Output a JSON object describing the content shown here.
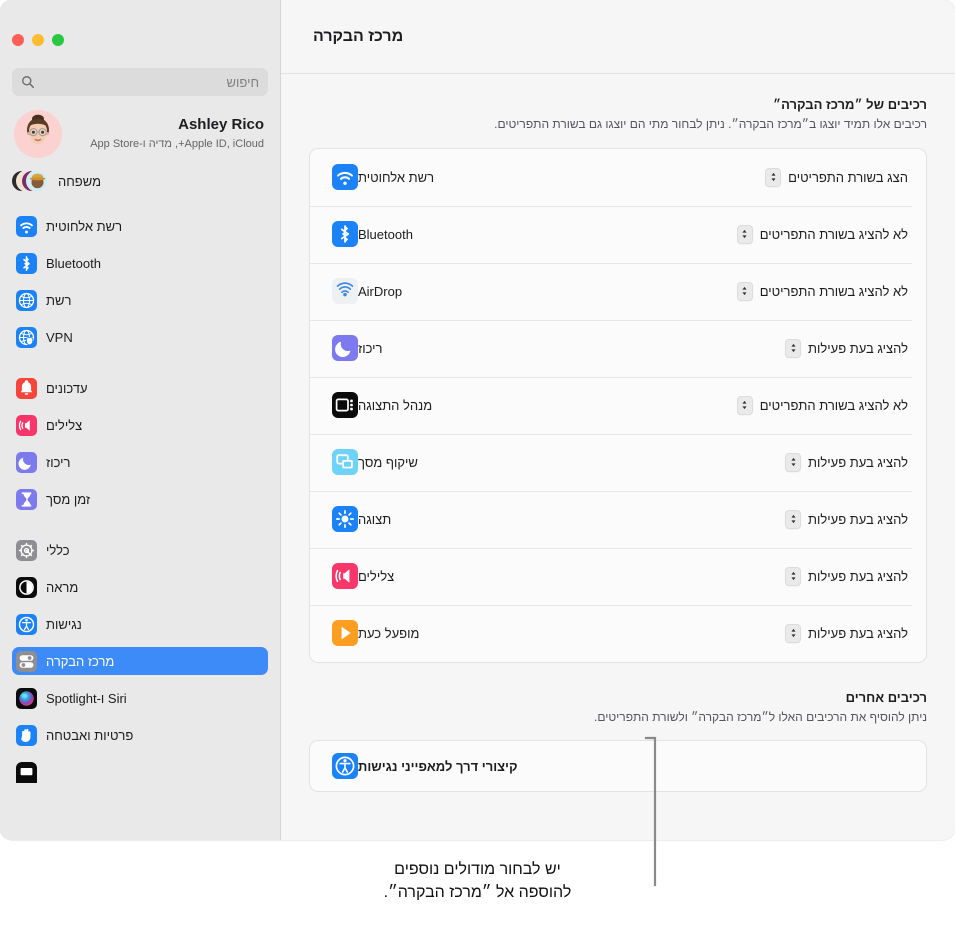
{
  "window": {
    "traffic_lights": [
      "close",
      "minimize",
      "maximize"
    ],
    "title": "מרכז הבקרה"
  },
  "sidebar": {
    "search": {
      "placeholder": "חיפוש",
      "icon": "search-icon"
    },
    "account": {
      "name": "Ashley Rico",
      "subtitle": "Apple ID, iCloud+, מדיה ו-App Store",
      "avatar": "memoji-avatar"
    },
    "family": {
      "label": "משפחה",
      "icon": "family-avatars"
    },
    "groups": [
      {
        "items": [
          {
            "label": "רשת אלחוטית",
            "icon": "wifi-icon",
            "selected": false
          },
          {
            "label": "Bluetooth",
            "icon": "bluetooth-icon",
            "selected": false
          },
          {
            "label": "רשת",
            "icon": "network-globe-icon",
            "selected": false
          },
          {
            "label": "VPN",
            "icon": "vpn-globe-icon",
            "selected": false
          }
        ]
      },
      {
        "items": [
          {
            "label": "עדכונים",
            "icon": "notifications-bell-icon",
            "selected": false
          },
          {
            "label": "צלילים",
            "icon": "sound-speaker-icon",
            "selected": false
          },
          {
            "label": "ריכוז",
            "icon": "focus-moon-icon",
            "selected": false
          },
          {
            "label": "זמן מסך",
            "icon": "screen-time-hourglass-icon",
            "selected": false
          }
        ]
      },
      {
        "items": [
          {
            "label": "כללי",
            "icon": "general-gear-icon",
            "selected": false
          },
          {
            "label": "מראה",
            "icon": "appearance-contrast-icon",
            "selected": false
          },
          {
            "label": "נגישות",
            "icon": "accessibility-icon",
            "selected": false
          },
          {
            "label": "מרכז הבקרה",
            "icon": "control-center-icon",
            "selected": true
          },
          {
            "label": "Siri ו-Spotlight",
            "icon": "siri-icon",
            "selected": false
          },
          {
            "label": "פרטיות ואבטחה",
            "icon": "privacy-hand-icon",
            "selected": false
          }
        ]
      }
    ]
  },
  "main": {
    "section": {
      "title": "רכיבים של ״מרכז הבקרה״",
      "description": "רכיבים אלו תמיד יוצגו ב״מרכז הבקרה״. ניתן לבחור מתי הם יוצגו גם בשורת התפריטים."
    },
    "rows": [
      {
        "label": "רשת אלחוטית",
        "icon": "wifi-icon",
        "value": "הצג בשורת התפריטים"
      },
      {
        "label": "Bluetooth",
        "icon": "bluetooth-icon",
        "value": "לא להציג בשורת התפריטים"
      },
      {
        "label": "AirDrop",
        "icon": "airdrop-icon",
        "value": "לא להציג בשורת התפריטים"
      },
      {
        "label": "ריכוז",
        "icon": "focus-moon-icon",
        "value": "להציג בעת פעילות"
      },
      {
        "label": "מנהל התצוגה",
        "icon": "stage-manager-icon",
        "value": "לא להציג בשורת התפריטים"
      },
      {
        "label": "שיקוף מסך",
        "icon": "screen-mirroring-icon",
        "value": "להציג בעת פעילות"
      },
      {
        "label": "תצוגה",
        "icon": "display-brightness-icon",
        "value": "להציג בעת פעילות"
      },
      {
        "label": "צלילים",
        "icon": "sound-speaker-icon",
        "value": "להציג בעת פעילות"
      },
      {
        "label": "מופעל כעת",
        "icon": "now-playing-icon",
        "value": "להציג בעת פעילות"
      }
    ],
    "other_section": {
      "title": "רכיבים אחרים",
      "description": "ניתן להוסיף את הרכיבים האלו ל״מרכז הבקרה״ ולשורת התפריטים.",
      "rows": [
        {
          "label": "קיצורי דרך למאפייני נגישות",
          "icon": "accessibility-icon"
        }
      ]
    }
  },
  "callout": {
    "text_line1": "יש לבחור מודולים נוספים",
    "text_line2": "להוספה אל ״מרכז הבקרה״."
  },
  "colors": {
    "accent_blue": "#3d8bf8",
    "sidebar_bg": "#e9e9e9",
    "content_bg": "#f6f6f6",
    "card_bg": "#fbfbfb",
    "traffic_close": "#ff5f57",
    "traffic_min": "#febc2e",
    "traffic_max": "#28c840"
  }
}
